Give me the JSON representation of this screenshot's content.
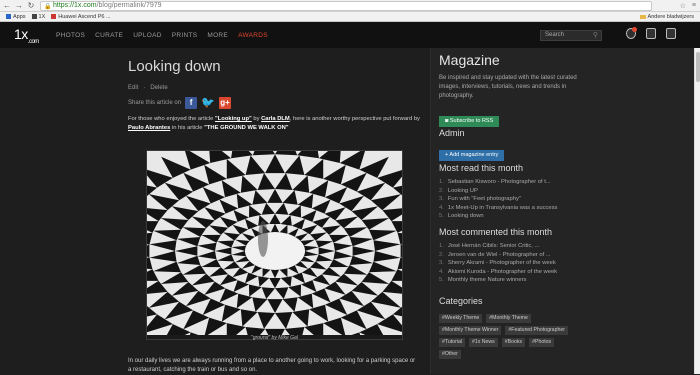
{
  "browser": {
    "url_main": "https://1x.com",
    "url_rest": "/blog/permalink/7979",
    "bookmarks": [
      "Apps",
      "1X",
      "Huawei Ascend P6 ..."
    ],
    "profile": "Andere bladwijzers"
  },
  "header": {
    "logo": "1x",
    "nav": [
      "PHOTOS",
      "CURATE",
      "UPLOAD",
      "PRINTS",
      "MORE",
      "AWARDS"
    ],
    "search_placeholder": "Search"
  },
  "article": {
    "title": "Looking down",
    "edit": "Edit",
    "delete": "Delete",
    "share_label": "Share this article on",
    "intro_1": "For those who enjoyed the article ",
    "intro_link1": "\"Looking up\"",
    "intro_2": " by ",
    "intro_link2": "Carla DLM",
    "intro_3": ", here is another worthy perspective put forward by ",
    "intro_link3": "Paulo Abrantes",
    "intro_4": " in his article ",
    "intro_link4": "\"THE GROUND WE WALK ON\"",
    "caption": "\"ground\" by Mike Gal",
    "body": "In our daily lives we are always running from a place to another going to work, looking for a parking space or a restaurant, catching the train or bus and so on."
  },
  "sidebar": {
    "title": "Magazine",
    "desc": "Be inspired and stay updated with the latest curated images, interviews, tutorials, news and trends in photography.",
    "subscribe": "Subscribe to RSS",
    "admin_h": "Admin",
    "add_entry": "+ Add magazine entry",
    "most_read_h": "Most read this month",
    "most_read": [
      "Sebastian Kisworo - Photographer of t...",
      "Looking UP",
      "Fun with \"Feet photography\"",
      "1x Meet-Up in Transylvania was a success",
      "Looking down"
    ],
    "most_commented_h": "Most commented this month",
    "most_commented": [
      "José Hernán Cibils: Senior Critic, ...",
      "Jeroen van de Wiel - Photographer of ...",
      "Sherry Akrami - Photographer of the week",
      "Akiomi Kuroda - Photographer of the week",
      "Monthly theme Nature winners"
    ],
    "categories_h": "Categories",
    "categories": [
      "#Weekly Theme",
      "#Monthly Theme",
      "#Monthly Theme Winner",
      "#Featured Photographer",
      "#Tutorial",
      "#1x News",
      "#Books",
      "#Photos",
      "#Other"
    ]
  },
  "colors": {
    "accent": "#e2472f",
    "rss": "#2e8b57",
    "admin": "#2e6fa8"
  }
}
